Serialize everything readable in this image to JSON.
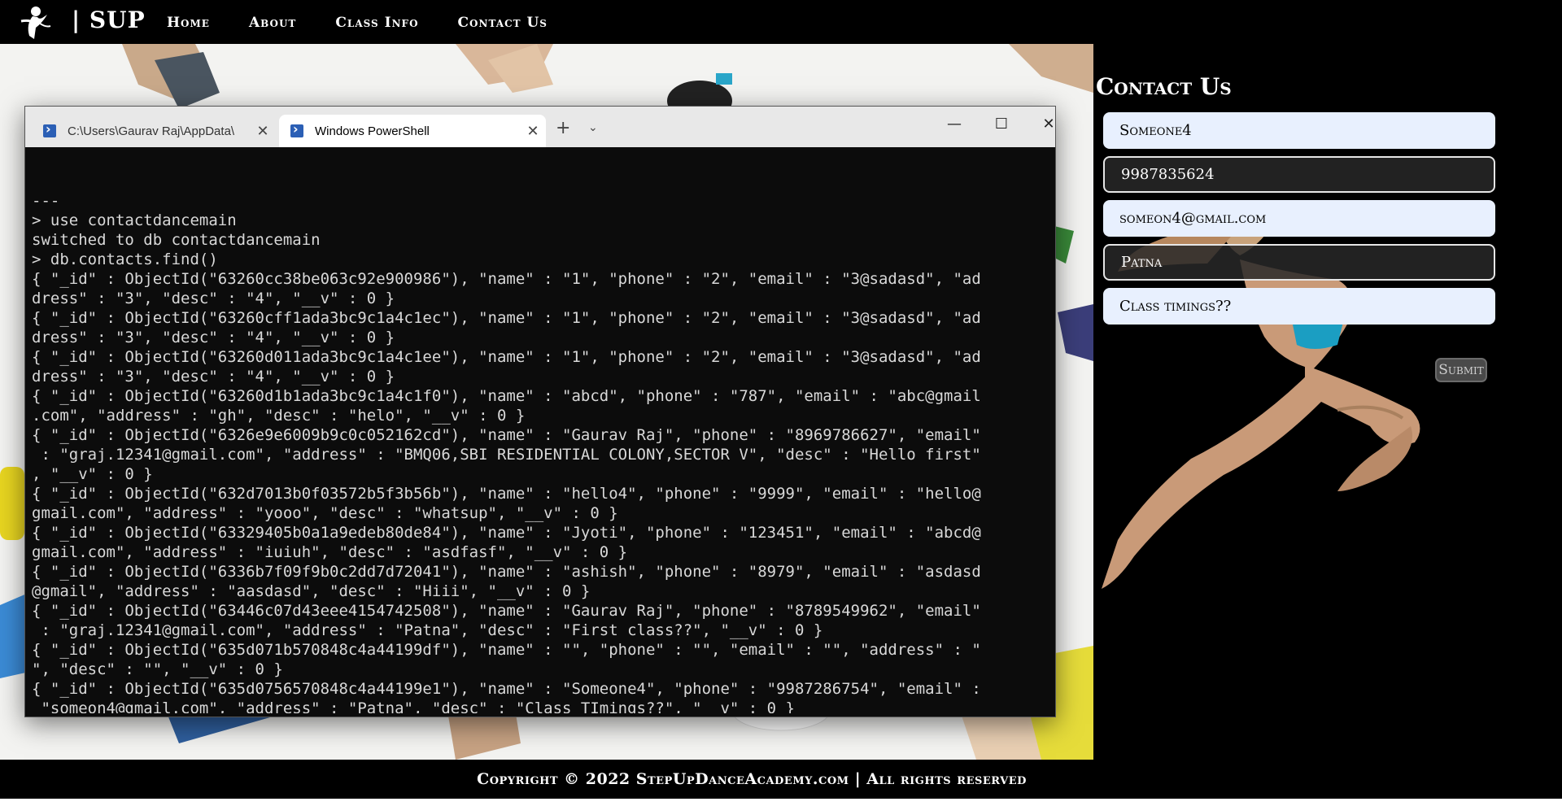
{
  "nav": {
    "brand": "| SUP",
    "links": [
      "Home",
      "About",
      "Class Info",
      "Contact Us"
    ]
  },
  "contact": {
    "title": "Contact Us",
    "name": "Someone4",
    "phone": "9987835624",
    "email": "someon4@gmail.com",
    "address": "Patna",
    "desc": "Class timings??",
    "submit": "Submit"
  },
  "footer": {
    "text": "Copyright © 2022 StepUpDanceAcademy.com | All rights reserved"
  },
  "terminal": {
    "tabs": [
      {
        "label": "C:\\Users\\Gaurav Raj\\AppData\\",
        "active": false
      },
      {
        "label": "Windows PowerShell",
        "active": true
      }
    ],
    "new_tab": "+",
    "dropdown": "⌄",
    "controls": {
      "minimize": "—",
      "maximize": "☐",
      "close": "✕"
    },
    "lines": [
      "---",
      "> use contactdancemain",
      "switched to db contactdancemain",
      "> db.contacts.find()",
      "{ \"_id\" : ObjectId(\"63260cc38be063c92e900986\"), \"name\" : \"1\", \"phone\" : \"2\", \"email\" : \"3@sadasd\", \"ad",
      "dress\" : \"3\", \"desc\" : \"4\", \"__v\" : 0 }",
      "{ \"_id\" : ObjectId(\"63260cff1ada3bc9c1a4c1ec\"), \"name\" : \"1\", \"phone\" : \"2\", \"email\" : \"3@sadasd\", \"ad",
      "dress\" : \"3\", \"desc\" : \"4\", \"__v\" : 0 }",
      "{ \"_id\" : ObjectId(\"63260d011ada3bc9c1a4c1ee\"), \"name\" : \"1\", \"phone\" : \"2\", \"email\" : \"3@sadasd\", \"ad",
      "dress\" : \"3\", \"desc\" : \"4\", \"__v\" : 0 }",
      "{ \"_id\" : ObjectId(\"63260d1b1ada3bc9c1a4c1f0\"), \"name\" : \"abcd\", \"phone\" : \"787\", \"email\" : \"abc@gmail",
      ".com\", \"address\" : \"gh\", \"desc\" : \"helo\", \"__v\" : 0 }",
      "{ \"_id\" : ObjectId(\"6326e9e6009b9c0c052162cd\"), \"name\" : \"Gaurav Raj\", \"phone\" : \"8969786627\", \"email\"",
      " : \"graj.12341@gmail.com\", \"address\" : \"BMQ06,SBI RESIDENTIAL COLONY,SECTOR V\", \"desc\" : \"Hello first\"",
      ", \"__v\" : 0 }",
      "{ \"_id\" : ObjectId(\"632d7013b0f03572b5f3b56b\"), \"name\" : \"hello4\", \"phone\" : \"9999\", \"email\" : \"hello@",
      "gmail.com\", \"address\" : \"yooo\", \"desc\" : \"whatsup\", \"__v\" : 0 }",
      "{ \"_id\" : ObjectId(\"63329405b0a1a9edeb80de84\"), \"name\" : \"Jyoti\", \"phone\" : \"123451\", \"email\" : \"abcd@",
      "gmail.com\", \"address\" : \"iuiuh\", \"desc\" : \"asdfasf\", \"__v\" : 0 }",
      "{ \"_id\" : ObjectId(\"6336b7f09f9b0c2dd7d72041\"), \"name\" : \"ashish\", \"phone\" : \"8979\", \"email\" : \"asdasd",
      "@gmail\", \"address\" : \"aasdasd\", \"desc\" : \"Hiii\", \"__v\" : 0 }",
      "{ \"_id\" : ObjectId(\"63446c07d43eee4154742508\"), \"name\" : \"Gaurav Raj\", \"phone\" : \"8789549962\", \"email\"",
      " : \"graj.12341@gmail.com\", \"address\" : \"Patna\", \"desc\" : \"First class??\", \"__v\" : 0 }",
      "{ \"_id\" : ObjectId(\"635d071b570848c4a44199df\"), \"name\" : \"\", \"phone\" : \"\", \"email\" : \"\", \"address\" : \"",
      "\", \"desc\" : \"\", \"__v\" : 0 }",
      "{ \"_id\" : ObjectId(\"635d0756570848c4a44199e1\"), \"name\" : \"Someone4\", \"phone\" : \"9987286754\", \"email\" :",
      " \"someon4@gmail.com\", \"address\" : \"Patna\", \"desc\" : \"Class TImings??\", \"__v\" : 0 }"
    ],
    "prompt": "> "
  }
}
